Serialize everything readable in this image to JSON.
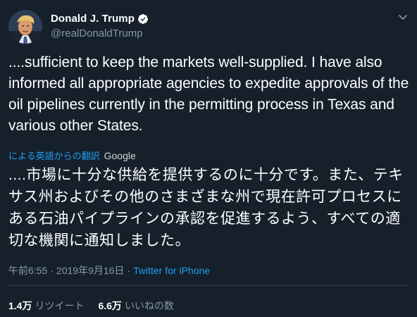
{
  "author": {
    "display_name": "Donald J. Trump",
    "handle": "@realDonaldTrump",
    "verified_icon": "verified-badge-icon",
    "avatar_alt": "profile photo"
  },
  "tweet": {
    "text": "....sufficient to keep the markets well-supplied. I have also informed all appropriate agencies to expedite approvals of the oil pipelines currently in the permitting process in Texas and various other States.",
    "translate_link": "による英語からの翻訳",
    "translate_provider": "Google",
    "translated_text": "....市場に十分な供給を提供するのに十分です。また、テキサス州およびその他のさまざまな州で現在許可プロセスにある石油パイプラインの承認を促進するよう、すべての適切な機関に通知しました。",
    "time": "午前6:55",
    "separator": "·",
    "date": "2019年9月16日",
    "source": "Twitter for iPhone"
  },
  "stats": {
    "retweets_count": "1.4万",
    "retweets_label": "リツイート",
    "likes_count": "6.6万",
    "likes_label": "いいねの数"
  },
  "colors": {
    "background": "#15202b",
    "accent": "#1da1f2",
    "secondary_text": "#8899a6",
    "divider": "#38444d"
  }
}
